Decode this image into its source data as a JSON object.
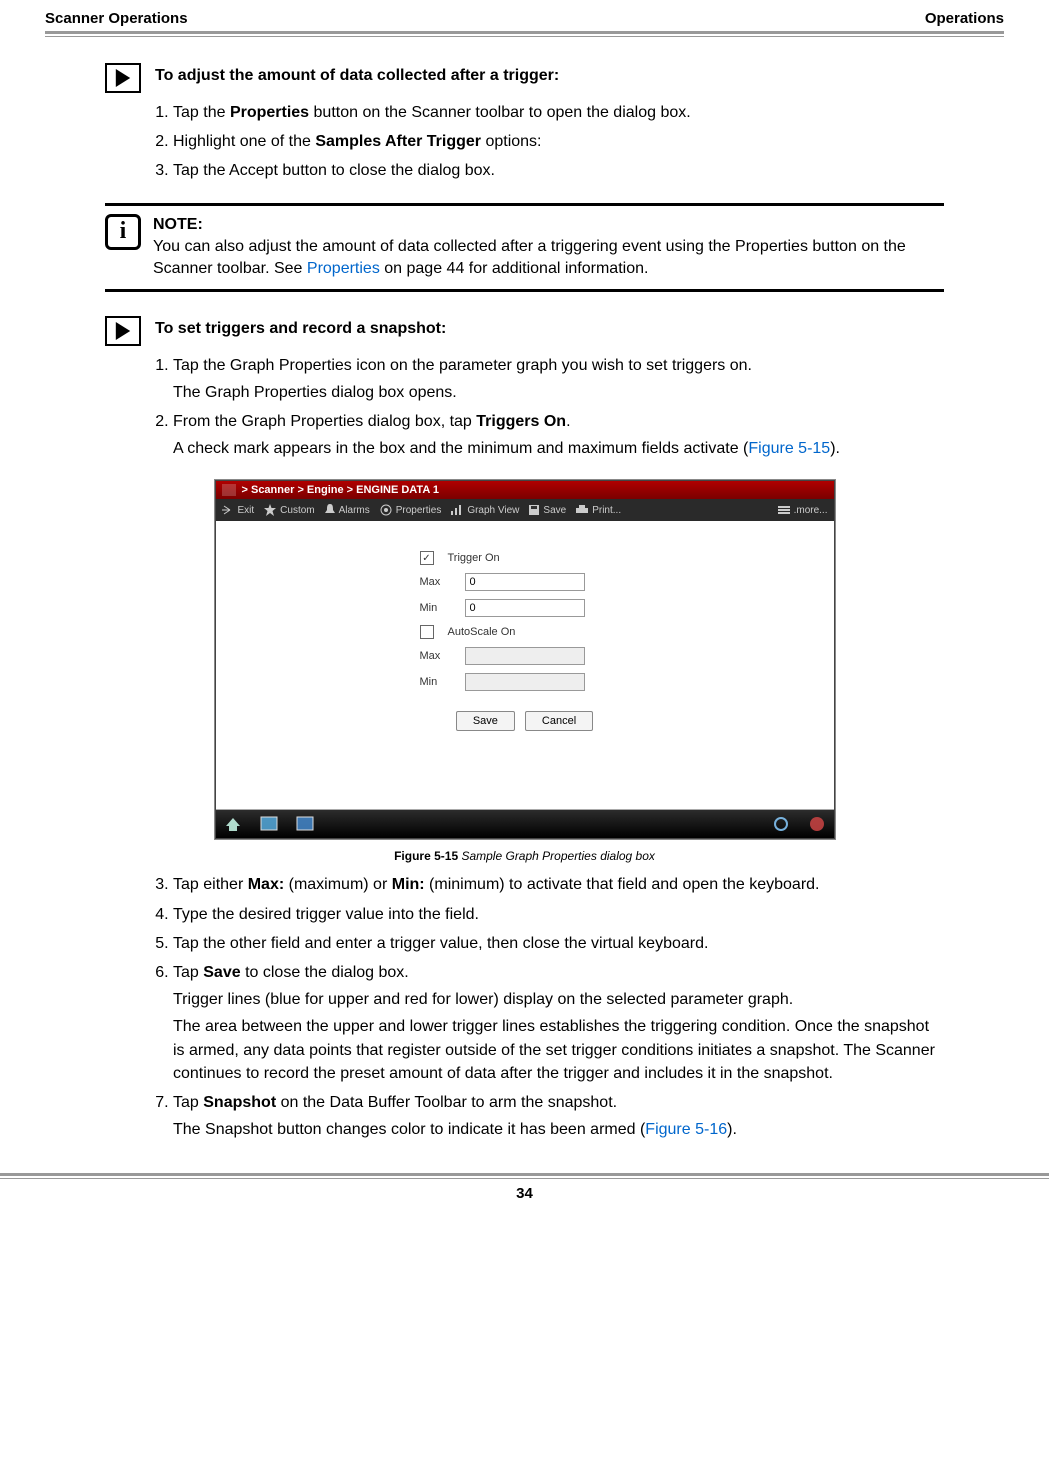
{
  "header": {
    "left": "Scanner Operations",
    "right": "Operations"
  },
  "proc1": {
    "title": "To adjust the amount of data collected after a trigger:",
    "steps": [
      {
        "pre": "Tap the ",
        "b1": "Properties",
        "post": " button on the Scanner toolbar to open the dialog box."
      },
      {
        "pre": "Highlight one of the ",
        "b1": "Samples After Trigger",
        "post": " options:"
      },
      {
        "pre": "Tap the Accept button to close the dialog box.",
        "b1": "",
        "post": ""
      }
    ]
  },
  "note": {
    "label": "NOTE:",
    "text_a": "You can also adjust the amount of data collected after a triggering event using the Properties button on the Scanner toolbar. See ",
    "link": "Properties",
    "text_b": " on page 44 for additional information."
  },
  "proc2": {
    "title": "To set triggers and record a snapshot:",
    "s1": "Tap the Graph Properties icon on the parameter graph you wish to set triggers on.",
    "s1sub": "The Graph Properties dialog box opens.",
    "s2a": "From the Graph Properties dialog box, tap ",
    "s2b": "Triggers On",
    "s2c": ".",
    "s2sub_a": "A check mark appears in the box and the minimum and maximum fields activate (",
    "s2sub_link": "Figure 5-15",
    "s2sub_b": ")."
  },
  "figure": {
    "titlebar": "> Scanner  > Engine  > ENGINE DATA 1",
    "toolbar": {
      "exit": "Exit",
      "custom": "Custom",
      "alarms": "Alarms",
      "properties": "Properties",
      "graphview": "Graph View",
      "save": "Save",
      "print": "Print...",
      "more": ".more..."
    },
    "form": {
      "trigger_on": "Trigger On",
      "trigger_checked": "✓",
      "max": "Max",
      "min": "Min",
      "max_val": "0",
      "min_val": "0",
      "autoscale": "AutoScale On",
      "save": "Save",
      "cancel": "Cancel"
    },
    "caption_b": "Figure 5-15",
    "caption_i": " Sample Graph Properties dialog box"
  },
  "proc3": {
    "s3a": "Tap either ",
    "s3b": "Max:",
    "s3c": " (maximum) or ",
    "s3d": "Min:",
    "s3e": " (minimum) to activate that field and open the keyboard.",
    "s4": "Type the desired trigger value into the field.",
    "s5": "Tap the other field and enter a trigger value, then close the virtual keyboard.",
    "s6a": "Tap ",
    "s6b": "Save",
    "s6c": " to close the dialog box.",
    "s6sub1": "Trigger lines (blue for upper and red for lower) display on the selected parameter graph.",
    "s6sub2": "The area between the upper and lower trigger lines establishes the triggering condition. Once the snapshot is armed, any data points that register outside of the set trigger conditions initiates a snapshot. The Scanner continues to record the preset amount of data after the trigger and includes it in the snapshot.",
    "s7a": "Tap ",
    "s7b": "Snapshot",
    "s7c": " on the Data Buffer Toolbar to arm the snapshot.",
    "s7sub_a": "The Snapshot button changes color to indicate it has been armed (",
    "s7sub_link": "Figure 5-16",
    "s7sub_b": ")."
  },
  "page_number": "34"
}
